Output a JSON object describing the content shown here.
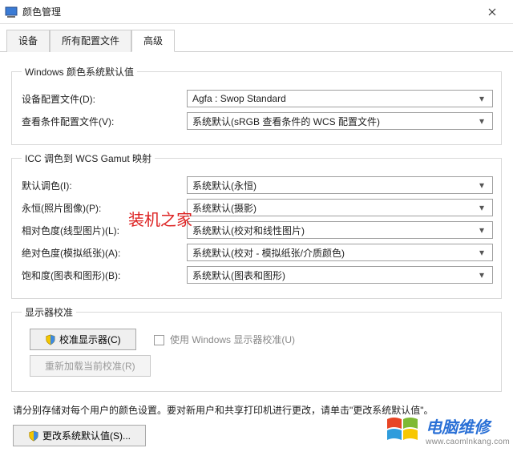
{
  "window": {
    "title": "颜色管理",
    "close_icon": "close"
  },
  "tabs": {
    "devices": "设备",
    "all_profiles": "所有配置文件",
    "advanced": "高级"
  },
  "group_defaults": {
    "legend": "Windows 颜色系统默认值",
    "device_profile_label": "设备配置文件(D):",
    "device_profile_value": "Agfa : Swop Standard",
    "viewing_cond_label": "查看条件配置文件(V):",
    "viewing_cond_value": "系统默认(sRGB 查看条件的 WCS 配置文件)"
  },
  "group_icc": {
    "legend": "ICC 调色到 WCS Gamut 映射",
    "default_intent_label": "默认调色(I):",
    "default_intent_value": "系统默认(永恒)",
    "perpetual_label": "永恒(照片图像)(P):",
    "perpetual_value": "系统默认(摄影)",
    "relative_label": "相对色度(线型图片)(L):",
    "relative_value": "系统默认(校对和线性图片)",
    "absolute_label": "绝对色度(模拟纸张)(A):",
    "absolute_value": "系统默认(校对 - 模拟纸张/介质颜色)",
    "saturation_label": "饱和度(图表和图形)(B):",
    "saturation_value": "系统默认(图表和图形)"
  },
  "group_calib": {
    "legend": "显示器校准",
    "calibrate_btn": "校准显示器(C)",
    "use_windows_calib": "使用 Windows 显示器校准(U)",
    "reload_btn": "重新加载当前校准(R)"
  },
  "note": "请分别存储对每个用户的颜色设置。要对新用户和共享打印机进行更改，请单击\"更改系统默认值\"。",
  "change_defaults_btn": "更改系统默认值(S)...",
  "watermark": "装机之家",
  "footer": {
    "brand": "电脑维修",
    "url": "www.caomlnkang.com"
  }
}
